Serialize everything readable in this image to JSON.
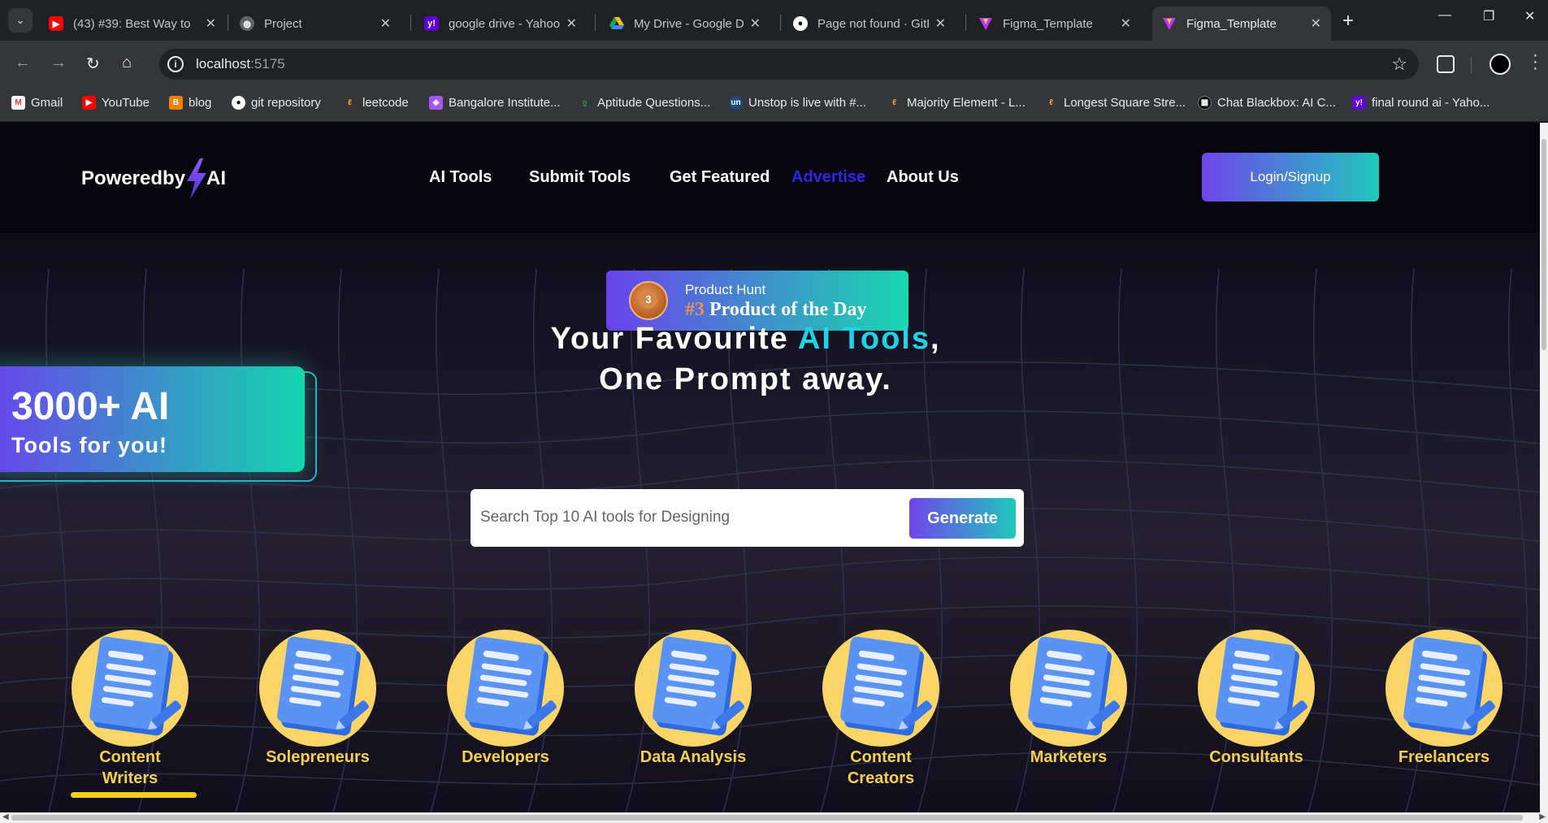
{
  "browser": {
    "tabs": [
      {
        "title": "(43) #39: Best Way to",
        "icon": "youtube-icon",
        "color": "#ff0000"
      },
      {
        "title": "Project",
        "icon": "globe-icon",
        "color": "#9aa0a6"
      },
      {
        "title": "google drive - Yahoo",
        "icon": "yahoo-icon",
        "color": "#6001d2"
      },
      {
        "title": "My Drive - Google Dr",
        "icon": "google-drive-icon",
        "color": "#1fa463"
      },
      {
        "title": "Page not found · GitH",
        "icon": "github-icon",
        "color": "#ffffff"
      },
      {
        "title": "Figma_Template",
        "icon": "vite-icon",
        "color": "#bd34fe"
      },
      {
        "title": "Figma_Template",
        "icon": "vite-icon",
        "color": "#bd34fe"
      }
    ],
    "url_host": "localhost",
    "url_port": ":5175",
    "bookmarks": [
      {
        "label": "Gmail",
        "icon": "gmail-icon",
        "color": "#ea4335"
      },
      {
        "label": "YouTube",
        "icon": "youtube-icon",
        "color": "#ff0000"
      },
      {
        "label": "blog",
        "icon": "blogger-icon",
        "color": "#f57d00"
      },
      {
        "label": "git repository",
        "icon": "github-icon",
        "color": "#ffffff"
      },
      {
        "label": "leetcode",
        "icon": "leetcode-icon",
        "color": "#ffa116"
      },
      {
        "label": "Bangalore Institute...",
        "icon": "institute-icon",
        "color": "#a855f7"
      },
      {
        "label": "Aptitude Questions...",
        "icon": "geeksforgeeks-icon",
        "color": "#2f8d46"
      },
      {
        "label": "Unstop is live with #...",
        "icon": "unstop-icon",
        "color": "#1c4980"
      },
      {
        "label": "Majority Element - L...",
        "icon": "leetcode-icon",
        "color": "#ffa116"
      },
      {
        "label": "Longest Square Stre...",
        "icon": "leetcode-icon",
        "color": "#ffa116"
      },
      {
        "label": "Chat Blackbox: AI C...",
        "icon": "blackbox-icon",
        "color": "#000000"
      },
      {
        "label": "final round ai - Yaho...",
        "icon": "yahoo-icon",
        "color": "#6001d2"
      }
    ]
  },
  "header": {
    "logo_text_left": "Poweredby",
    "logo_text_right": "AI",
    "nav": [
      {
        "label": "AI Tools"
      },
      {
        "label": "Submit Tools"
      },
      {
        "label": "Get Featured"
      },
      {
        "label": "Advertise"
      },
      {
        "label": "About Us"
      }
    ],
    "login_label": "Login/Signup"
  },
  "badge": {
    "label": "Product Hunt",
    "rank": "#3",
    "title": "Product of the Day",
    "medal_number": "3"
  },
  "count_card": {
    "big": "3000+ AI",
    "small": "Tools for you!"
  },
  "hero": {
    "line1_before": "Your Favourite ",
    "line1_highlight": "AI Tools",
    "line1_after": ",",
    "line2": "One Prompt away."
  },
  "search": {
    "placeholder": "Search Top 10 AI tools for Designing",
    "button_label": "Generate"
  },
  "categories": [
    {
      "label": "Content Writers",
      "line1": "Content",
      "line2": "Writers",
      "active": true
    },
    {
      "label": "Solepreneurs",
      "line1": "Solepreneurs",
      "line2": "",
      "active": false
    },
    {
      "label": "Developers",
      "line1": "Developers",
      "line2": "",
      "active": false
    },
    {
      "label": "Data Analysis",
      "line1": "Data Analysis",
      "line2": "",
      "active": false
    },
    {
      "label": "Content Creators",
      "line1": "Content",
      "line2": "Creators",
      "active": false
    },
    {
      "label": "Marketers",
      "line1": "Marketers",
      "line2": "",
      "active": false
    },
    {
      "label": "Consultants",
      "line1": "Consultants",
      "line2": "",
      "active": false
    },
    {
      "label": "Freelancers",
      "line1": "Freelancers",
      "line2": "",
      "active": false
    }
  ],
  "colors": {
    "accent_gradient_start": "#6f45ea",
    "accent_gradient_end": "#1fc8bd",
    "highlight_cyan": "#1fd3e6",
    "category_label": "#f5cf4e",
    "active_nav": "#2f26e8"
  }
}
